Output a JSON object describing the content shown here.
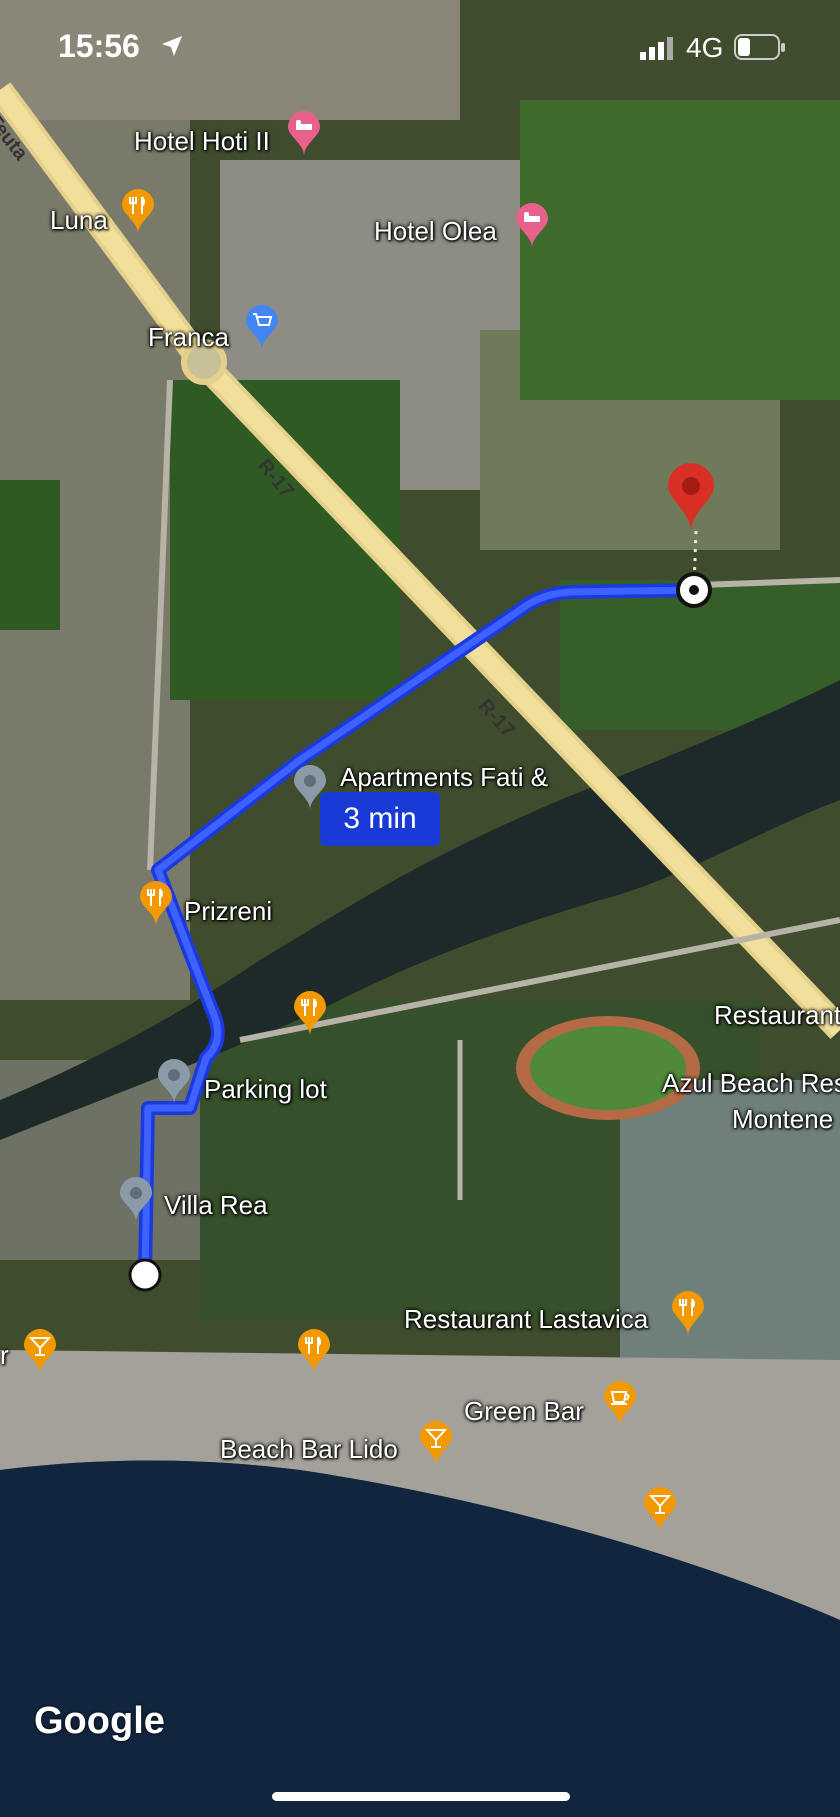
{
  "status_bar": {
    "time": "15:56",
    "network": "4G"
  },
  "route": {
    "eta": "3 min"
  },
  "roads": {
    "teuta": "Teuta",
    "r17_upper": "R-17",
    "r17_lower": "R-17"
  },
  "places": {
    "hotel_hoti": "Hotel Hoti II",
    "luna": "Luna",
    "hotel_olea": "Hotel Olea",
    "franca": "Franca",
    "apartments": "Apartments Fati &",
    "prizreni": "Prizreni",
    "parking": "Parking lot",
    "villa_rea": "Villa Rea",
    "restaurant_right": "Restaurant",
    "azul_1": "Azul Beach Res",
    "azul_2": "Montene",
    "lastavica": "Restaurant Lastavica",
    "green_bar": "Green Bar",
    "beach_bar_lido": "Beach Bar Lido",
    "left_edge": "r"
  },
  "branding": {
    "google": "Google"
  },
  "colors": {
    "route": "#1a3ae0",
    "destination_pin": "#d93025",
    "food_pin": "#f29900",
    "hotel_pin": "#e8608c",
    "shop_pin": "#4285f4",
    "generic_pin": "#8a9aa8"
  }
}
